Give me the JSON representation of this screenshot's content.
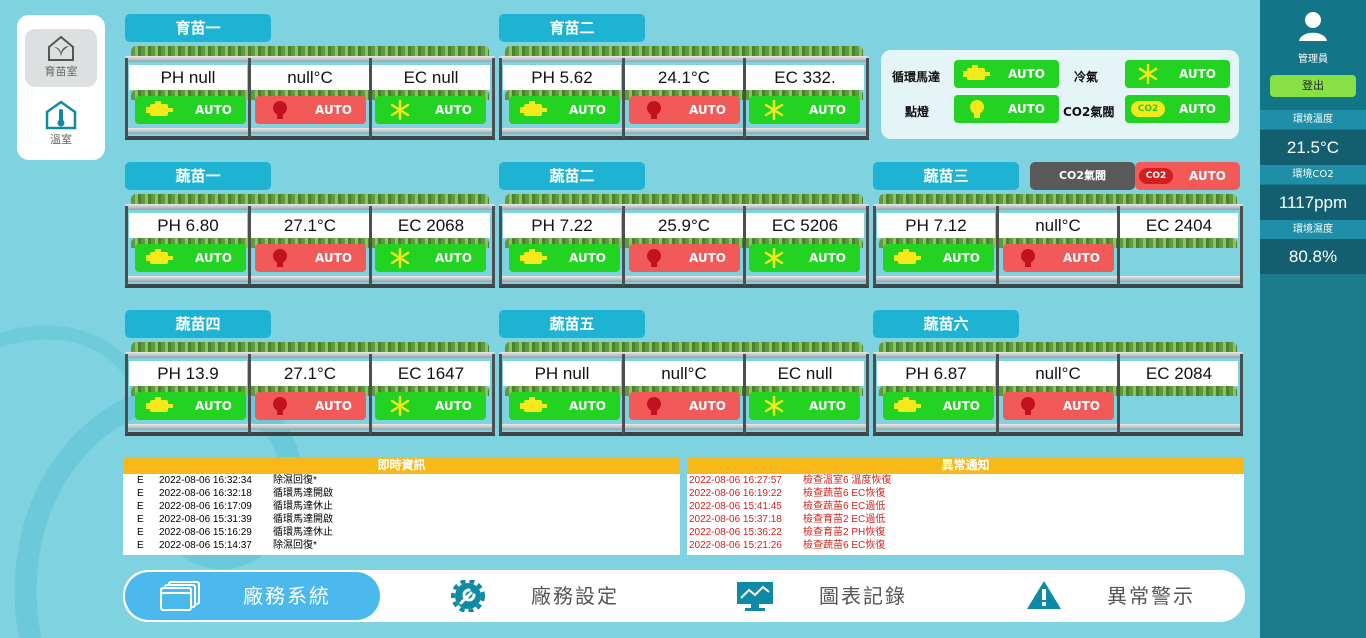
{
  "nav": [
    {
      "label": "育苗室",
      "icon": "greenhouse-icon",
      "active": true
    },
    {
      "label": "溫室",
      "icon": "thermometer-house-icon",
      "active": false
    }
  ],
  "zones": [
    {
      "name": "育苗一",
      "ph": "PH null",
      "temp": "null°C",
      "ec": "EC null",
      "buttons": [
        "pump",
        "light",
        "cooler"
      ]
    },
    {
      "name": "育苗二",
      "ph": "PH 5.62",
      "temp": "24.1°C",
      "ec": "EC 332.",
      "buttons": [
        "pump",
        "light",
        "cooler"
      ]
    },
    {
      "name": "蔬苗一",
      "ph": "PH 6.80",
      "temp": "27.1°C",
      "ec": "EC 2068",
      "buttons": [
        "pump",
        "light",
        "cooler"
      ]
    },
    {
      "name": "蔬苗二",
      "ph": "PH 7.22",
      "temp": "25.9°C",
      "ec": "EC 5206",
      "buttons": [
        "pump",
        "light",
        "cooler"
      ]
    },
    {
      "name": "蔬苗三",
      "ph": "PH 7.12",
      "temp": "null°C",
      "ec": "EC 2404",
      "buttons": [
        "pump",
        "light"
      ]
    },
    {
      "name": "蔬苗四",
      "ph": "PH 13.9",
      "temp": "27.1°C",
      "ec": "EC 1647",
      "buttons": [
        "pump",
        "light",
        "cooler"
      ]
    },
    {
      "name": "蔬苗五",
      "ph": "PH null",
      "temp": "null°C",
      "ec": "EC null",
      "buttons": [
        "pump",
        "light",
        "cooler"
      ]
    },
    {
      "name": "蔬苗六",
      "ph": "PH 6.87",
      "temp": "null°C",
      "ec": "EC 2084",
      "buttons": [
        "pump",
        "light"
      ]
    }
  ],
  "auto_label": "AUTO",
  "controls": {
    "pump_label": "循環馬達",
    "cooler_label": "冷氣",
    "light_label": "點燈",
    "co2_label": "CO2氣閥",
    "co2_badge": "CO2",
    "co2_valve_button": "CO2氣閥"
  },
  "info_log": {
    "title": "即時資訊",
    "entries": [
      {
        "level": "E",
        "time": "2022-08-06 16:32:34",
        "msg": "除濕回復*"
      },
      {
        "level": "E",
        "time": "2022-08-06 16:32:18",
        "msg": "循環馬達開啟"
      },
      {
        "level": "E",
        "time": "2022-08-06 16:17:09",
        "msg": "循環馬達休止"
      },
      {
        "level": "E",
        "time": "2022-08-06 15:31:39",
        "msg": "循環馬達開啟"
      },
      {
        "level": "E",
        "time": "2022-08-06 15:16:29",
        "msg": "循環馬達休止"
      },
      {
        "level": "E",
        "time": "2022-08-06 15:14:37",
        "msg": "除濕回復*"
      }
    ]
  },
  "alert_log": {
    "title": "異常通知",
    "entries": [
      {
        "time": "2022-08-06 16:27:57",
        "msg": "檢查溫室6 溫度恢復"
      },
      {
        "time": "2022-08-06 16:19:22",
        "msg": "檢查蔬苗6 EC恢復"
      },
      {
        "time": "2022-08-06 15:41:45",
        "msg": "檢查蔬苗6 EC過低"
      },
      {
        "time": "2022-08-06 15:37:18",
        "msg": "檢查育苗2 EC過低"
      },
      {
        "time": "2022-08-06 15:36:22",
        "msg": "檢查育苗2 PH恢復"
      },
      {
        "time": "2022-08-06 15:21:26",
        "msg": "檢查蔬苗6 EC恢復"
      }
    ]
  },
  "bottom_tabs": [
    {
      "label": "廠務系統",
      "icon": "windows-icon",
      "active": true
    },
    {
      "label": "廠務設定",
      "icon": "wrench-gear-icon",
      "active": false
    },
    {
      "label": "圖表記錄",
      "icon": "monitor-chart-icon",
      "active": false
    },
    {
      "label": "異常警示",
      "icon": "warning-icon",
      "active": false
    }
  ],
  "sidebar": {
    "user_name": "管理員",
    "logout": "登出",
    "env": [
      {
        "label": "環境溫度",
        "value": "21.5°C"
      },
      {
        "label": "環境CO2",
        "value": "1117ppm"
      },
      {
        "label": "環境濕度",
        "value": "80.8%"
      }
    ]
  },
  "colors": {
    "green": "#22d322",
    "red": "#f25a5a",
    "zone_label": "#1fb3d3",
    "log_header": "#f7b81a",
    "alert_text": "#d8201a",
    "active_tab": "#4cb9ee"
  }
}
